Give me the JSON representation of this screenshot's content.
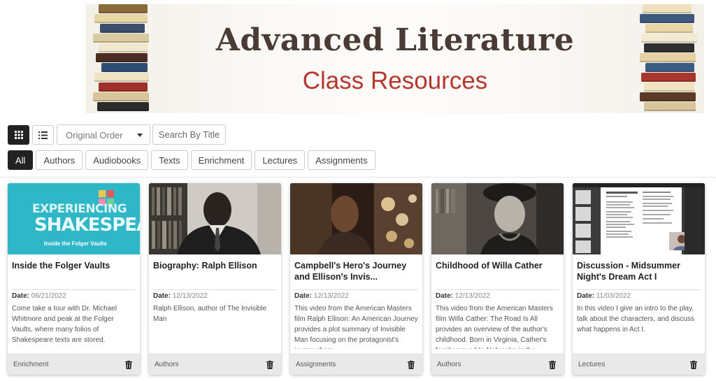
{
  "banner": {
    "title": "Advanced Literature",
    "subtitle": "Class Resources"
  },
  "toolbar": {
    "grid_view_icon": "grid-icon",
    "list_view_icon": "list-icon",
    "sort_value": "Original Order",
    "search_label": "Search By Title"
  },
  "filters": [
    {
      "label": "All",
      "active": true
    },
    {
      "label": "Authors",
      "active": false
    },
    {
      "label": "Audiobooks",
      "active": false
    },
    {
      "label": "Texts",
      "active": false
    },
    {
      "label": "Enrichment",
      "active": false
    },
    {
      "label": "Lectures",
      "active": false
    },
    {
      "label": "Assignments",
      "active": false
    }
  ],
  "cards": [
    {
      "title": "Inside the Folger Vaults",
      "date_label": "Date:",
      "date": "06/21/2022",
      "description": "Come take a tour with Dr. Michael Whitmore and peak at the Folger Vaults, where many folios of Shakespeare texts are stored.",
      "category": "Enrichment",
      "thumb_text": [
        "EXPERIENCING",
        "SHAKESPEARE",
        "Inside the Folger Vaults"
      ]
    },
    {
      "title": "Biography: Ralph Ellison",
      "date_label": "Date:",
      "date": "12/13/2022",
      "description": "Ralph Ellison, author of The Invisible Man",
      "category": "Authors"
    },
    {
      "title": "Campbell's Hero's Journey and Ellison's Invis...",
      "date_label": "Date:",
      "date": "12/13/2022",
      "description": "This video from the American Masters film Ralph Ellison: An American Journey provides a plot summary of Invisible Man focusing on the protagonist's journey from",
      "category": "Assignments"
    },
    {
      "title": "Childhood of Willa Cather",
      "date_label": "Date:",
      "date": "12/13/2022",
      "description": "This video from the American Masters film Willa Cather: The Road Is All provides an overview of the author's childhood.  Born in Virginia, Cather's family moved to Nebraska in the",
      "category": "Authors"
    },
    {
      "title": "Discussion - Midsummer Night's Dream Act I",
      "date_label": "Date:",
      "date": "11/03/2022",
      "description": "In this video I give an intro to the play, talk about the characters, and discuss what happens in Act I.",
      "category": "Lectures"
    }
  ],
  "colors": {
    "banner_title": "#4a3b35",
    "banner_subtitle": "#b5372d",
    "active_filter": "#222222"
  }
}
